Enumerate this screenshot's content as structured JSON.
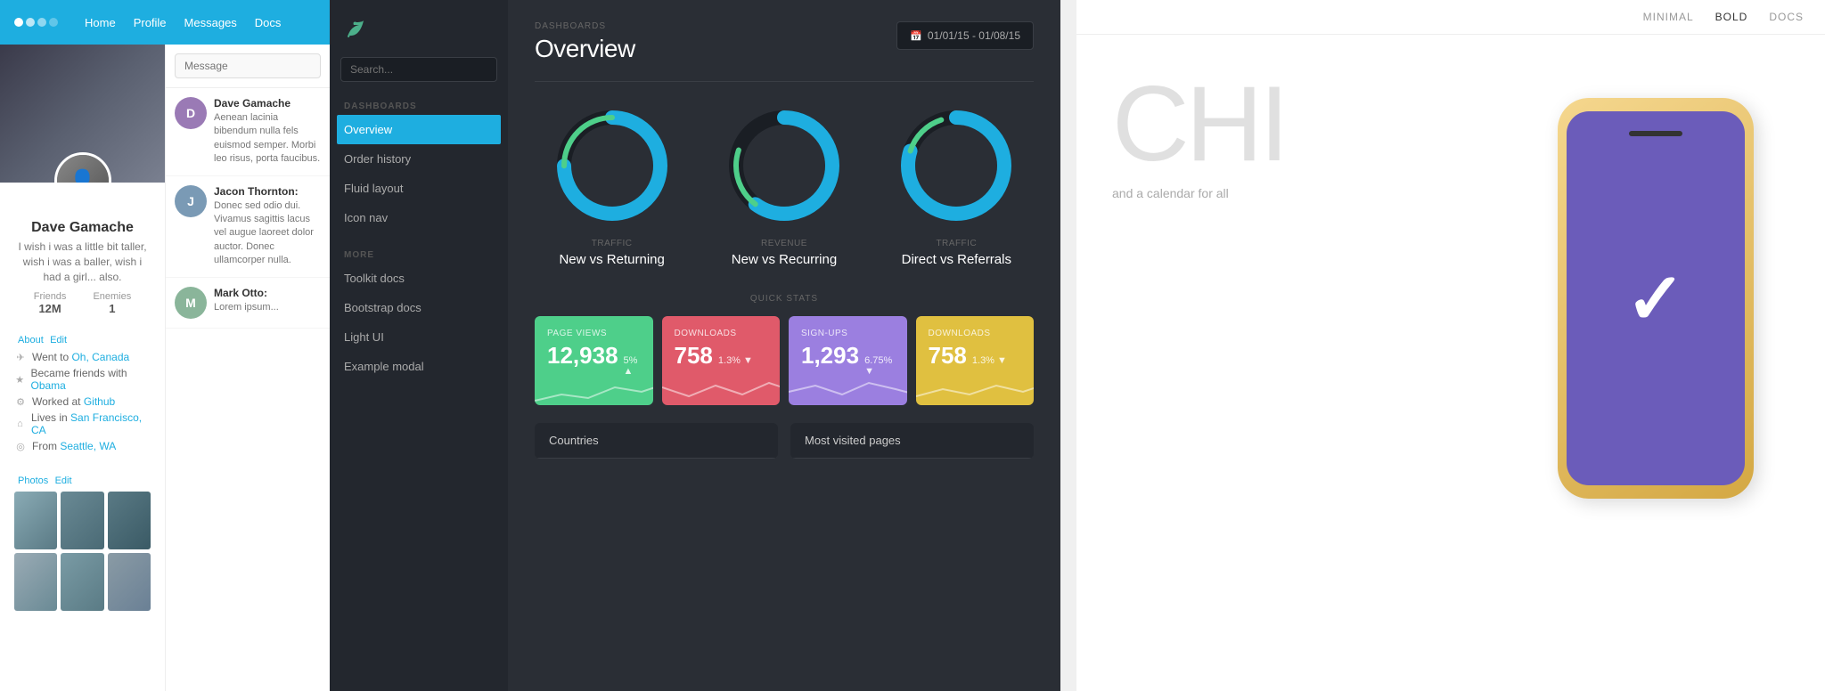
{
  "social": {
    "topbar": {
      "logo_text": "oooo",
      "nav_items": [
        "Home",
        "Profile",
        "Messages",
        "Docs"
      ]
    },
    "profile": {
      "name": "Dave Gamache",
      "bio": "I wish i was a little bit taller, wish i was a baller, wish i had a girl... also.",
      "friends": "12M",
      "enemies": "1"
    },
    "about": {
      "title": "About",
      "edit_label": "Edit",
      "items": [
        {
          "icon": "◻",
          "text": "Went to ",
          "link": "Oh, Canada"
        },
        {
          "icon": "◻",
          "text": "Became friends with ",
          "link": "Obama"
        },
        {
          "icon": "◻",
          "text": "Worked at ",
          "link": "Github"
        },
        {
          "icon": "◻",
          "text": "Lives in ",
          "link": "San Francisco, CA"
        },
        {
          "icon": "◻",
          "text": "From ",
          "link": "Seattle, WA"
        }
      ]
    },
    "photos": {
      "title": "Photos",
      "edit_label": "Edit"
    }
  },
  "messages": {
    "input_placeholder": "Message",
    "items": [
      {
        "name": "Dave Gamache",
        "avatar_color": "#9a7ab5",
        "avatar_letter": "D",
        "text": "Aenean lacinia bibendum nulla fels euismod semper. Morbi leo risus, porta faucibus."
      },
      {
        "name": "Jacon Thornton:",
        "avatar_color": "#7a9ab5",
        "avatar_letter": "J",
        "text": "Donec sed odio dui. Vivamus sagittis lacus vel augue laoreet dolor auctor. Donec ullamcorper nulla."
      },
      {
        "name": "Mark Otto:",
        "avatar_color": "#8ab59a",
        "avatar_letter": "M",
        "text": "Lorem ipsum..."
      }
    ]
  },
  "right_panel": {
    "nav_items": [
      "MINIMAL",
      "BOLD",
      "DOCS"
    ],
    "big_text": "CHI",
    "tagline": "and a calendar for all"
  },
  "modal": {
    "sidebar": {
      "section_dashboards": "DASHBOARDS",
      "section_more": "MORE",
      "nav_dashboards": [
        {
          "label": "Overview",
          "active": true
        },
        {
          "label": "Order history",
          "active": false
        },
        {
          "label": "Fluid layout",
          "active": false
        },
        {
          "label": "Icon nav",
          "active": false
        }
      ],
      "nav_more": [
        {
          "label": "Toolkit docs",
          "active": false
        },
        {
          "label": "Bootstrap docs",
          "active": false
        },
        {
          "label": "Light UI",
          "active": false
        },
        {
          "label": "Example modal",
          "active": false
        }
      ],
      "search_placeholder": "Search..."
    },
    "header": {
      "breadcrumb": "DASHBOARDS",
      "title": "Overview",
      "date_range": "01/01/15 - 01/08/15"
    },
    "charts": [
      {
        "subtitle": "Traffic",
        "title": "New vs Returning",
        "blue_pct": 75,
        "green_pct": 25
      },
      {
        "subtitle": "Revenue",
        "title": "New vs Recurring",
        "blue_pct": 60,
        "green_pct": 20
      },
      {
        "subtitle": "Traffic",
        "title": "Direct vs Referrals",
        "blue_pct": 80,
        "green_pct": 15
      }
    ],
    "quick_stats_label": "QUICK STATS",
    "stat_cards": [
      {
        "label": "PAGE VIEWS",
        "value": "12,938",
        "change": "5% ▲",
        "color_class": "stat-card-green"
      },
      {
        "label": "DOWNLOADS",
        "value": "758",
        "change": "1.3% ▼",
        "color_class": "stat-card-red"
      },
      {
        "label": "SIGN-UPS",
        "value": "1,293",
        "change": "6.75% ▼",
        "color_class": "stat-card-purple"
      },
      {
        "label": "DOWNLOADS",
        "value": "758",
        "change": "1.3% ▼",
        "color_class": "stat-card-yellow"
      }
    ],
    "bottom_tables": [
      {
        "title": "Countries"
      },
      {
        "title": "Most visited pages"
      }
    ]
  }
}
